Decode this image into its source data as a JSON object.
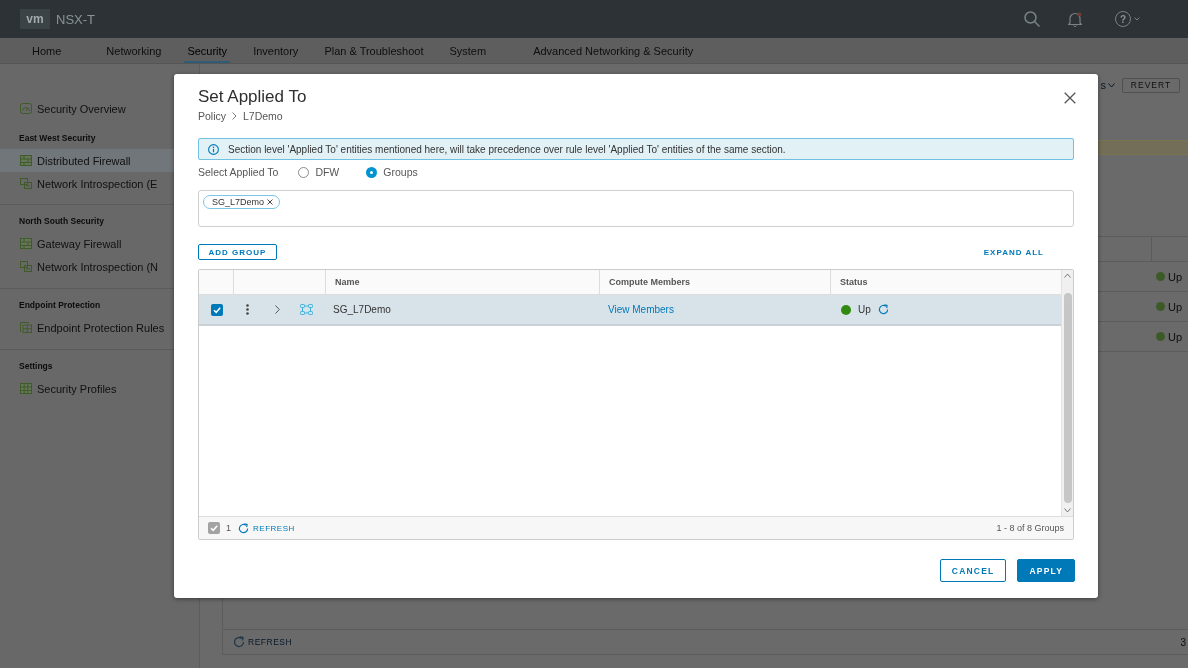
{
  "header": {
    "logo": "vm",
    "product": "NSX-T",
    "help": "?"
  },
  "nav": [
    {
      "label": "Home",
      "selected": false
    },
    {
      "label": "Networking",
      "selected": false
    },
    {
      "label": "Security",
      "selected": true
    },
    {
      "label": "Inventory",
      "selected": false
    },
    {
      "label": "Plan & Troubleshoot",
      "selected": false
    },
    {
      "label": "System",
      "selected": false
    },
    {
      "label": "Advanced Networking & Security",
      "selected": false
    }
  ],
  "sidebar": [
    {
      "items": [
        {
          "kind": "overview",
          "label": "Security Overview",
          "selected": false
        }
      ]
    },
    {
      "heading": "East West Security",
      "items": [
        {
          "kind": "firewall",
          "label": "Distributed Firewall",
          "selected": true
        },
        {
          "kind": "introspection",
          "label": "Network Introspection (E",
          "selected": false
        }
      ]
    },
    {
      "heading": "North South Security",
      "items": [
        {
          "kind": "firewall",
          "label": "Gateway Firewall",
          "selected": false
        },
        {
          "kind": "introspection",
          "label": "Network Introspection (N",
          "selected": false
        }
      ]
    },
    {
      "heading": "Endpoint Protection",
      "items": [
        {
          "kind": "endpoint",
          "label": "Endpoint Protection Rules",
          "selected": false
        }
      ]
    },
    {
      "heading": "Settings",
      "items": [
        {
          "kind": "profiles",
          "label": "Security Profiles",
          "selected": false
        }
      ]
    }
  ],
  "toolbar": {
    "menu_label": "s",
    "revert_button": "REVERT"
  },
  "rules_table": {
    "rows": [
      {
        "status": "Up"
      },
      {
        "status": "Up"
      },
      {
        "status": "Up"
      }
    ],
    "refresh": "REFRESH",
    "count": "3"
  },
  "dialog": {
    "title": "Set Applied To",
    "breadcrumb": [
      "Policy",
      "L7Demo"
    ],
    "info": "Section level 'Applied To' entities mentioned here, will take precedence over rule level 'Applied To' entities of the same section.",
    "applied_to": {
      "label": "Select Applied To",
      "options": [
        {
          "label": "DFW",
          "selected": false
        },
        {
          "label": "Groups",
          "selected": true
        }
      ]
    },
    "tags": [
      "SG_L7Demo"
    ],
    "add_button": "ADD GROUP",
    "expand_all": "EXPAND ALL",
    "table": {
      "columns": [
        "Name",
        "Compute Members",
        "Status"
      ],
      "rows": [
        {
          "checked": true,
          "selected": true,
          "expanded": false,
          "name": "SG_L7Demo",
          "members": "View Members",
          "status": "Up"
        }
      ],
      "footer": {
        "selected_count": "1",
        "refresh": "REFRESH",
        "pagination": "1 - 8 of 8 Groups"
      }
    },
    "buttons": [
      {
        "kind": "secondary",
        "label": "CANCEL"
      },
      {
        "kind": "primary",
        "label": "APPLY"
      }
    ]
  }
}
